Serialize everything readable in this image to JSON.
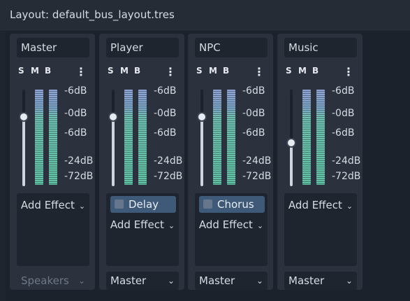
{
  "title": "Layout: default_bus_layout.tres",
  "smb": {
    "solo": "S",
    "mute": "M",
    "bypass": "B",
    "menu": "⋮"
  },
  "db_labels": [
    "-6dB",
    "-0dB",
    "-6dB",
    "-24dB",
    "-72dB"
  ],
  "add_effect_label": "Add Effect",
  "buses": [
    {
      "name": "Master",
      "send": "Speakers",
      "send_disabled": true,
      "effect": null,
      "volume_level": 0.72
    },
    {
      "name": "Player",
      "send": "Master",
      "send_disabled": false,
      "effect": "Delay",
      "volume_level": 0.72
    },
    {
      "name": "NPC",
      "send": "Master",
      "send_disabled": false,
      "effect": "Chorus",
      "volume_level": 0.72
    },
    {
      "name": "Music",
      "send": "Master",
      "send_disabled": false,
      "effect": null,
      "volume_level": 0.45
    }
  ]
}
